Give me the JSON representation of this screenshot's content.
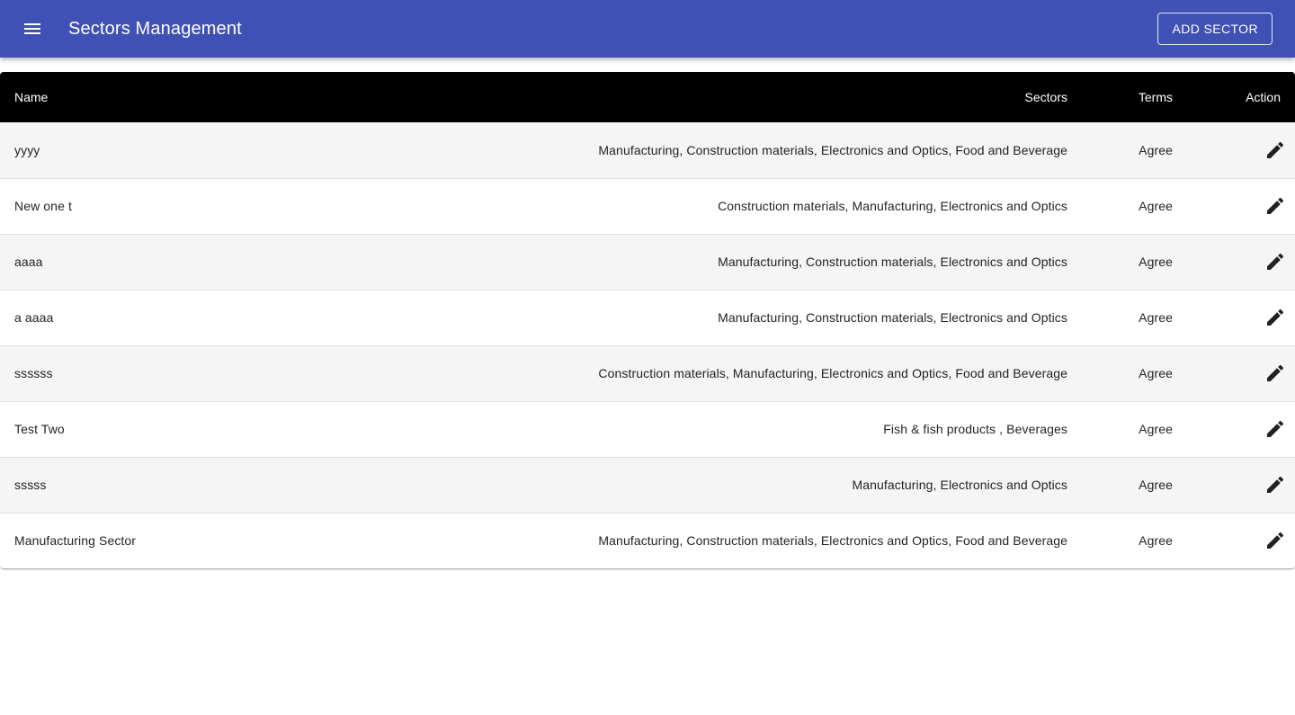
{
  "app_bar": {
    "title": "Sectors Management",
    "menu_icon": "menu-icon",
    "add_button_label": "ADD SECTOR",
    "color": "#3f51b5"
  },
  "table": {
    "headers": {
      "name": "Name",
      "sectors": "Sectors",
      "terms": "Terms",
      "action": "Action"
    },
    "header_bg": "#000000",
    "action_icon": "edit-icon",
    "rows": [
      {
        "name": "yyyy",
        "sectors": "Manufacturing, Construction materials, Electronics and Optics, Food and Beverage",
        "terms": "Agree"
      },
      {
        "name": "New one t",
        "sectors": "Construction materials, Manufacturing, Electronics and Optics",
        "terms": "Agree"
      },
      {
        "name": "aaaa",
        "sectors": "Manufacturing, Construction materials, Electronics and Optics",
        "terms": "Agree"
      },
      {
        "name": "a aaaa",
        "sectors": "Manufacturing, Construction materials, Electronics and Optics",
        "terms": "Agree"
      },
      {
        "name": "ssssss",
        "sectors": "Construction materials, Manufacturing, Electronics and Optics, Food and Beverage",
        "terms": "Agree"
      },
      {
        "name": "Test Two",
        "sectors": "Fish & fish products , Beverages",
        "terms": "Agree"
      },
      {
        "name": "sssss",
        "sectors": "Manufacturing, Electronics and Optics",
        "terms": "Agree"
      },
      {
        "name": "Manufacturing Sector",
        "sectors": "Manufacturing, Construction materials, Electronics and Optics, Food and Beverage",
        "terms": "Agree"
      }
    ]
  }
}
